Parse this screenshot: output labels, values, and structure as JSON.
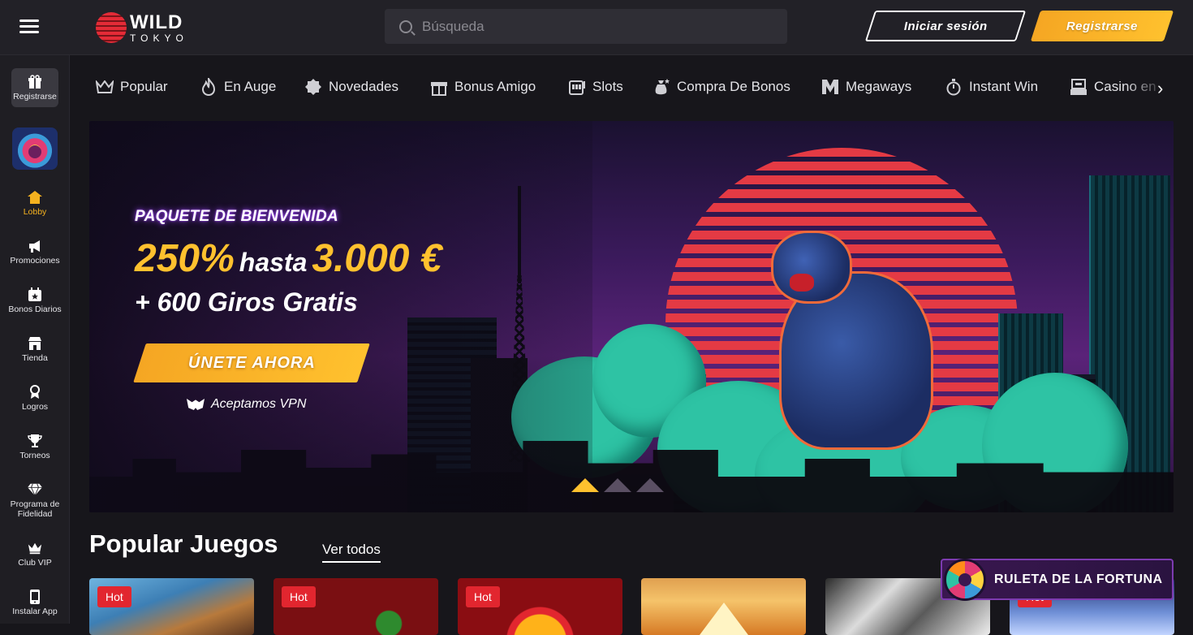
{
  "header": {
    "logo_word": "WILD",
    "logo_sub": "TOKYO",
    "search_placeholder": "Búsqueda",
    "login_label": "Iniciar sesión",
    "register_label": "Registrarse"
  },
  "sidebar": {
    "items": [
      {
        "label": "Registrarse",
        "icon": "gift-icon"
      },
      {
        "label": "Lobby",
        "icon": "home-icon",
        "active": true
      },
      {
        "label": "Promociones",
        "icon": "megaphone-icon"
      },
      {
        "label": "Bonos Diarios",
        "icon": "calendar-star-icon"
      },
      {
        "label": "Tienda",
        "icon": "store-icon"
      },
      {
        "label": "Logros",
        "icon": "medal-icon"
      },
      {
        "label": "Torneos",
        "icon": "trophy-icon"
      },
      {
        "label": "Programa de Fidelidad",
        "icon": "diamond-icon"
      },
      {
        "label": "Club VIP",
        "icon": "crown-icon"
      },
      {
        "label": "Instalar App",
        "icon": "phone-icon"
      }
    ]
  },
  "categories": [
    {
      "label": "Popular",
      "icon": "crown-icon"
    },
    {
      "label": "En Auge",
      "icon": "flame-icon"
    },
    {
      "label": "Novedades",
      "icon": "badge-icon"
    },
    {
      "label": "Bonus Amigo",
      "icon": "gift-icon"
    },
    {
      "label": "Slots",
      "icon": "slot-machine-icon"
    },
    {
      "label": "Compra De Bonos",
      "icon": "bag-icon"
    },
    {
      "label": "Megaways",
      "icon": "m-icon"
    },
    {
      "label": "Instant Win",
      "icon": "stopwatch-icon"
    },
    {
      "label": "Casino en",
      "icon": "cashier-icon"
    }
  ],
  "hero": {
    "tag": "PAQUETE DE BIENVENIDA",
    "percent": "250%",
    "hasta": "hasta",
    "amount": "3.000 €",
    "spins": "+ 600 Giros Gratis",
    "cta": "ÚNETE AHORA",
    "vpn": "Aceptamos VPN",
    "slides": 3,
    "active_slide": 1
  },
  "popular": {
    "title": "Popular Juegos",
    "see_all": "Ver todos",
    "games": [
      {
        "badge": "Hot"
      },
      {
        "badge": "Hot"
      },
      {
        "badge": "Hot"
      },
      {
        "badge": ""
      },
      {
        "badge": ""
      },
      {
        "badge": "Hot"
      }
    ]
  },
  "fortune": {
    "label": "RULETA DE LA FORTUNA"
  },
  "colors": {
    "accent": "#ffc12e",
    "background": "#17161b",
    "hot_badge": "#e2262f"
  }
}
